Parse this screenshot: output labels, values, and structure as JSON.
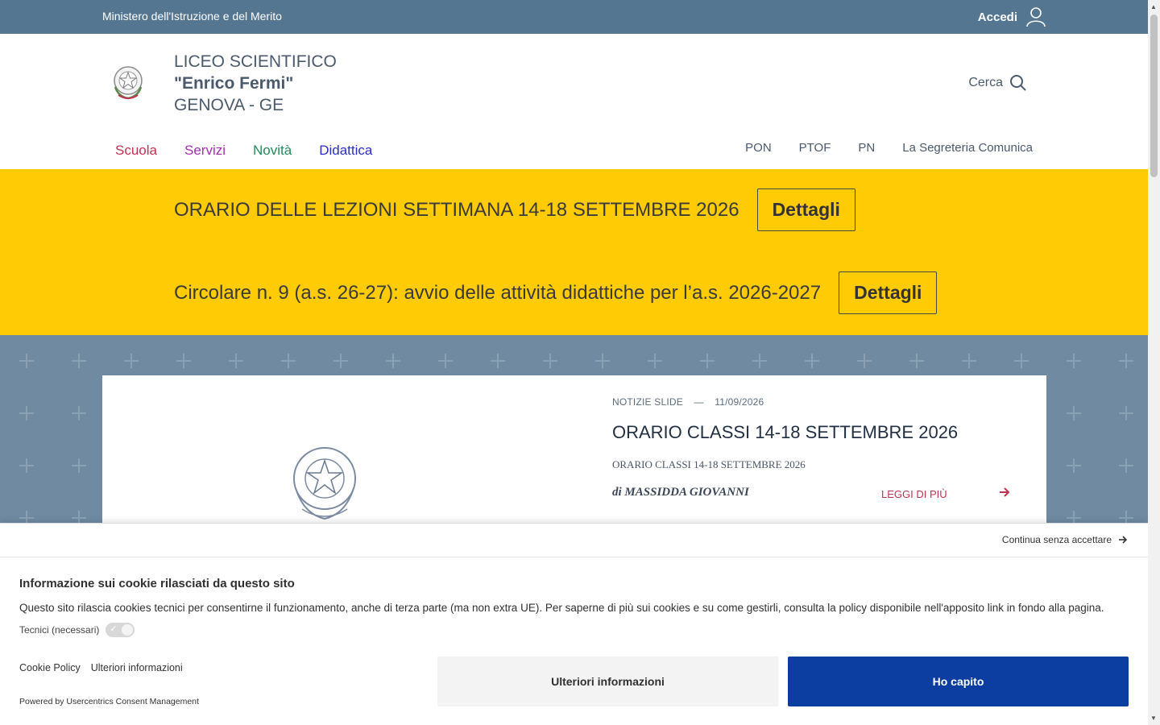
{
  "topbar": {
    "ministry": "Ministero dell'Istruzione e del Merito",
    "login_label": "Accedi"
  },
  "header": {
    "school_type": "LICEO SCIENTIFICO",
    "school_name": "\"Enrico Fermi\"",
    "school_city": "GENOVA - GE",
    "search_label": "Cerca"
  },
  "nav_main": [
    "Scuola",
    "Servizi",
    "Novità",
    "Didattica"
  ],
  "nav_secondary": [
    "PON",
    "PTOF",
    "PN",
    "La Segreteria Comunica"
  ],
  "alerts": [
    {
      "text": "ORARIO DELLE LEZIONI SETTIMANA 14-18 SETTEMBRE 2026",
      "button": "Dettagli"
    },
    {
      "text": "Circolare n. 9 (a.s. 26-27): avvio delle attività didattiche per l’a.s. 2026-2027",
      "button": "Dettagli"
    }
  ],
  "featured": {
    "category": "NOTIZIE SLIDE",
    "separator": "—",
    "date": "11/09/2026",
    "title": "ORARIO CLASSI 14-18 SETTEMBRE 2026",
    "subtitle": "ORARIO CLASSI 14-18 SETTEMBRE 2026",
    "author": "di MASSIDDA GIOVANNI",
    "read_more": "LEGGI DI PIÙ"
  },
  "cookie_banner": {
    "continue_label": "Continua senza accettare",
    "title": "Informazione sui cookie rilasciati da questo sito",
    "description": "Questo sito rilascia cookies tecnici per consentirne il funzionamento, anche di terza parte (ma non extra UE). Per saperne di più sui cookies e su come gestirli, consulta la policy disponibile nell'apposito link in fondo alla pagina.",
    "toggle_label": "Tecnici (necessari)",
    "link_policy": "Cookie Policy",
    "link_more": "Ulteriori informazioni",
    "powered_by": "Powered by Usercentrics Consent Management",
    "button_more": "Ulteriori informazioni",
    "button_ok": "Ho capito"
  },
  "colors": {
    "topbar": "#557690",
    "alert_bg": "#ffcb05",
    "hero_bg": "#6f8aa1",
    "accent_red": "#c0334f",
    "primary_button": "#0b3ea0"
  }
}
